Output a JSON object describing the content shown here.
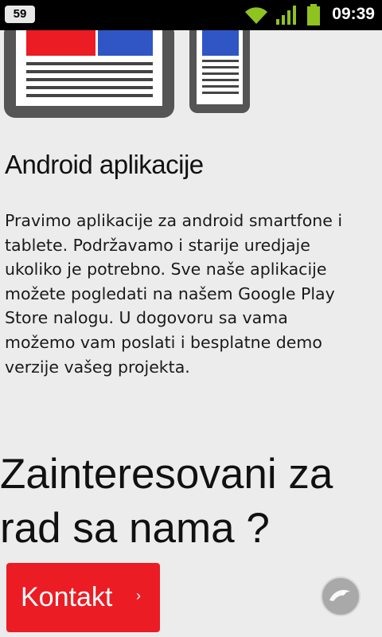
{
  "status_bar": {
    "notification_count": "59",
    "time": "09:39",
    "icons": [
      "wifi-icon",
      "signal-icon",
      "battery-icon"
    ]
  },
  "section": {
    "title": "Android aplikacije",
    "body": "Pravimo aplikacije za android smartfone i tablete. Podržavamo i starije uredjaje ukoliko je potrebno. Sve naše aplikacije možete pogledati na našem Google Play Store nalogu. U dogovoru sa vama možemo vam poslati i besplatne demo verzije vašeg projekta."
  },
  "cta": {
    "heading": "Zainteresovani za rad sa nama ?",
    "button_label": "Kontakt",
    "button_chevron": "›"
  },
  "colors": {
    "accent_red": "#ec1c24",
    "illustration_blue": "#2f56c4",
    "illustration_dark": "#555555"
  }
}
